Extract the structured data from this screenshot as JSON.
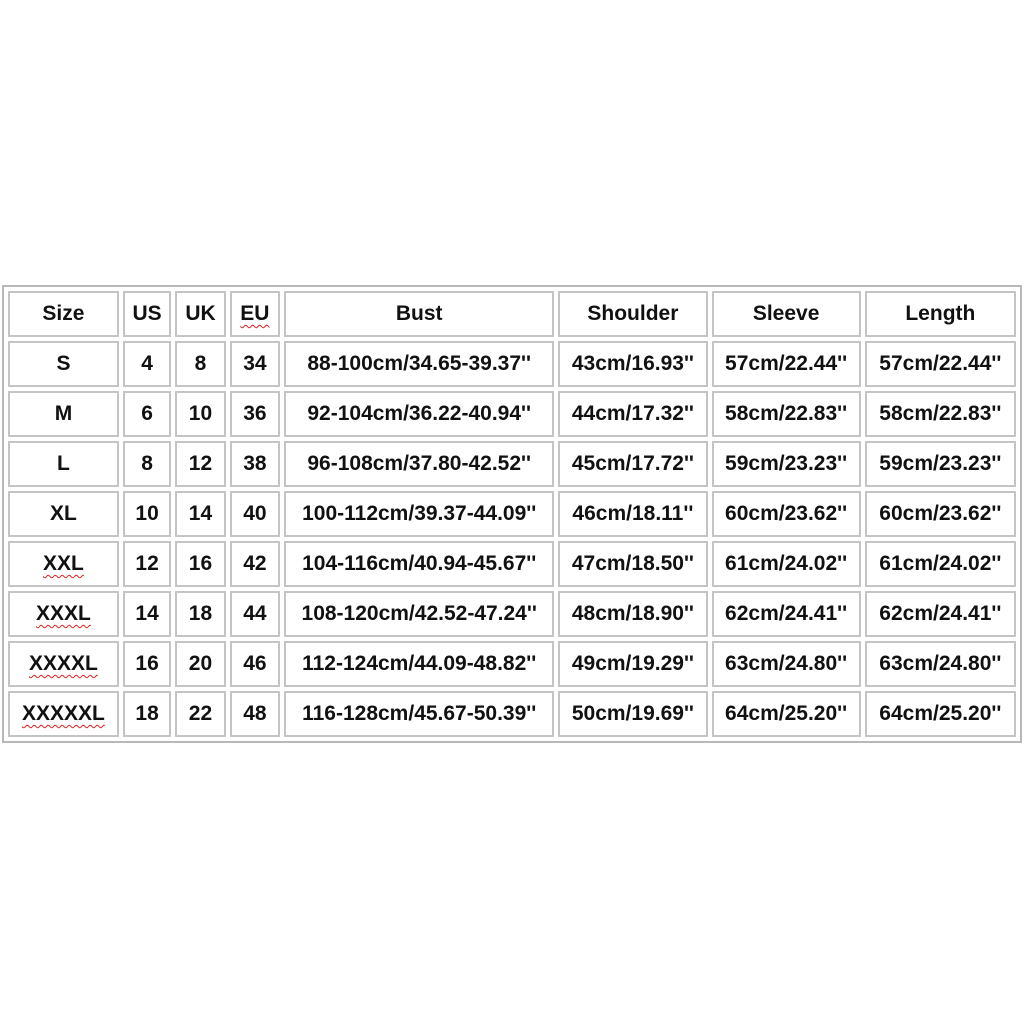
{
  "headers": [
    "Size",
    "US",
    "UK",
    "EU",
    "Bust",
    "Shoulder",
    "Sleeve",
    "Length"
  ],
  "spellcheck_flagged": [
    "EU",
    "XXL",
    "XXXL",
    "XXXXL",
    "XXXXXL"
  ],
  "rows": [
    [
      "S",
      "4",
      "8",
      "34",
      "88-100cm/34.65-39.37''",
      "43cm/16.93''",
      "57cm/22.44''",
      "57cm/22.44''"
    ],
    [
      "M",
      "6",
      "10",
      "36",
      "92-104cm/36.22-40.94''",
      "44cm/17.32''",
      "58cm/22.83''",
      "58cm/22.83''"
    ],
    [
      "L",
      "8",
      "12",
      "38",
      "96-108cm/37.80-42.52''",
      "45cm/17.72''",
      "59cm/23.23''",
      "59cm/23.23''"
    ],
    [
      "XL",
      "10",
      "14",
      "40",
      "100-112cm/39.37-44.09''",
      "46cm/18.11''",
      "60cm/23.62''",
      "60cm/23.62''"
    ],
    [
      "XXL",
      "12",
      "16",
      "42",
      "104-116cm/40.94-45.67''",
      "47cm/18.50''",
      "61cm/24.02''",
      "61cm/24.02''"
    ],
    [
      "XXXL",
      "14",
      "18",
      "44",
      "108-120cm/42.52-47.24''",
      "48cm/18.90''",
      "62cm/24.41''",
      "62cm/24.41''"
    ],
    [
      "XXXXL",
      "16",
      "20",
      "46",
      "112-124cm/44.09-48.82''",
      "49cm/19.29''",
      "63cm/24.80''",
      "63cm/24.80''"
    ],
    [
      "XXXXXL",
      "18",
      "22",
      "48",
      "116-128cm/45.67-50.39''",
      "50cm/19.69''",
      "64cm/25.20''",
      "64cm/25.20''"
    ]
  ]
}
